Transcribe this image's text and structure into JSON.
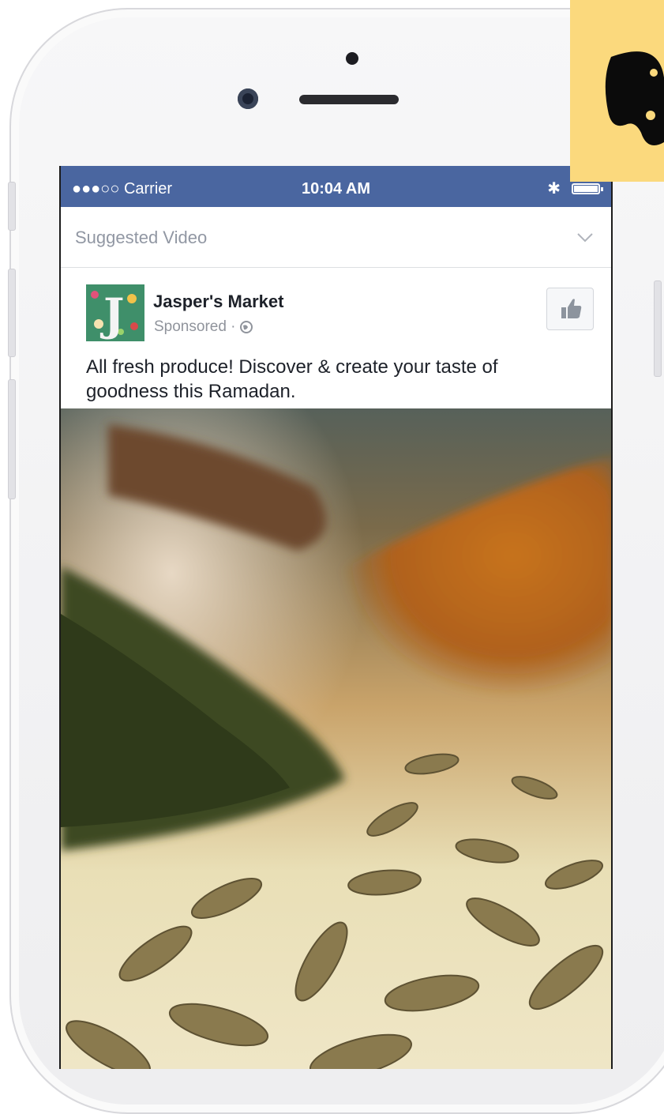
{
  "status_bar": {
    "carrier": "●●●○○ Carrier",
    "time": "10:04 AM",
    "bluetooth": "bluetooth-icon",
    "battery": "battery-icon"
  },
  "feed": {
    "section_label": "Suggested Video",
    "chevron": "chevron-down-icon"
  },
  "post": {
    "page_name": "Jasper's Market",
    "sponsored": "Sponsored · ",
    "privacy_icon": "globe-icon",
    "like_icon": "thumbs-up-icon",
    "text": "All fresh produce! Discover & create your taste of goodness this Ramadan.",
    "media": "spices-photo"
  },
  "colors": {
    "facebook_blue": "#4a66a0",
    "corner_badge": "#fbd97d"
  }
}
